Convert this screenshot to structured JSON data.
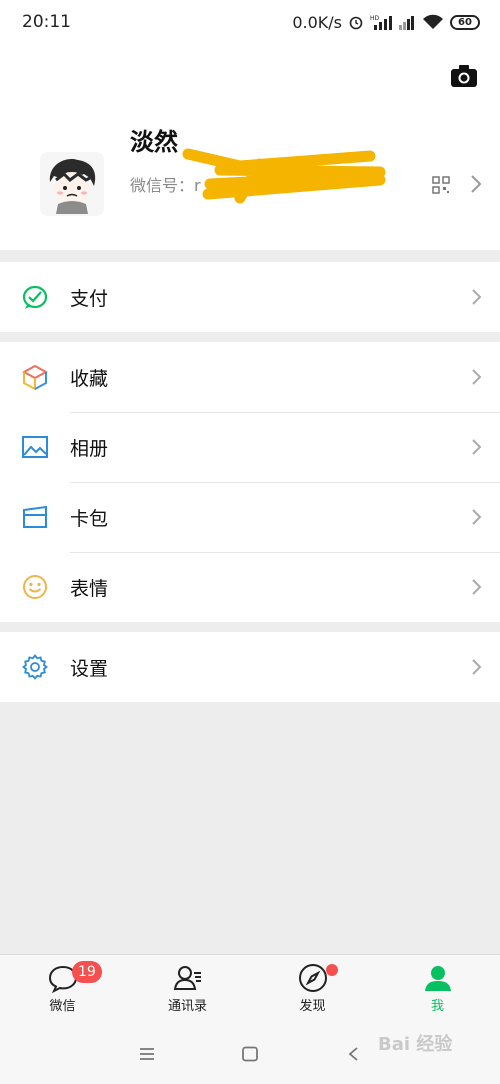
{
  "status_bar": {
    "time": "20:11",
    "speed": "0.0K/s",
    "battery": "60"
  },
  "profile": {
    "nickname": "淡然",
    "wechat_id_label": "微信号：r"
  },
  "menu": {
    "pay": "支付",
    "favorites": "收藏",
    "album": "相册",
    "cards": "卡包",
    "stickers": "表情",
    "settings": "设置"
  },
  "tabs": {
    "chats": "微信",
    "chats_badge": "19",
    "contacts": "通讯录",
    "discover": "发现",
    "me": "我"
  },
  "watermark": "Bai 经验",
  "colors": {
    "accent_green": "#07c160",
    "badge_red": "#f5504f"
  }
}
